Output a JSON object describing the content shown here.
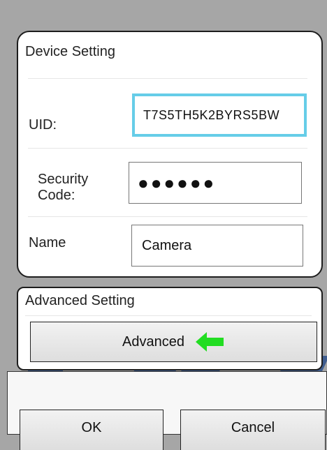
{
  "device_setting": {
    "title": "Device Setting",
    "uid": {
      "label": "UID:",
      "value": "T7S5TH5K2BYRS5BW"
    },
    "security": {
      "label_line1": "Security",
      "label_line2": "Code:",
      "value": "●●●●●●"
    },
    "name": {
      "label": "Name",
      "value": "Camera"
    }
  },
  "advanced_setting": {
    "title": "Advanced Setting",
    "button_label": "Advanced"
  },
  "actions": {
    "ok_label": "OK",
    "cancel_label": "Cancel"
  },
  "colors": {
    "accent_focus": "#66cde8",
    "arrow": "#22dd22",
    "watermark": "#3f5d8f"
  },
  "icons": {
    "advanced_arrow": "arrow-left-icon"
  }
}
